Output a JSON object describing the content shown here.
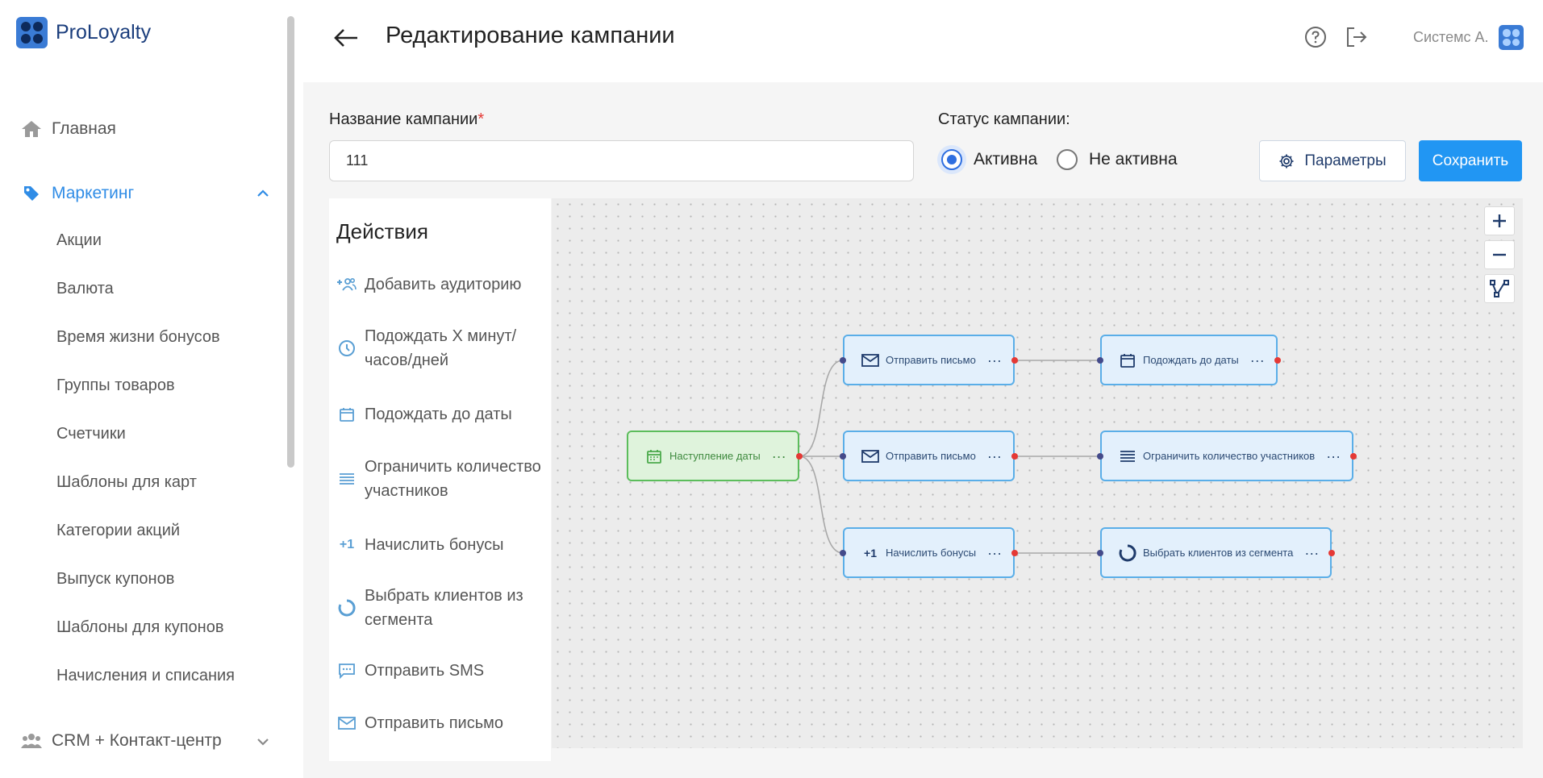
{
  "app": {
    "brand": "ProLoyalty"
  },
  "header": {
    "title": "Редактирование кампании",
    "user": "Системс А."
  },
  "sidebar": {
    "main_label": "Главная",
    "marketing_label": "Маркетинг",
    "marketing_items": [
      "Акции",
      "Валюта",
      "Время жизни бонусов",
      "Группы товаров",
      "Счетчики",
      "Шаблоны для карт",
      "Категории акций",
      "Выпуск купонов",
      "Шаблоны для купонов",
      "Начисления и списания"
    ],
    "crm_label": "CRM + Контакт-центр"
  },
  "form": {
    "name_label": "Название кампании",
    "name_required_mark": "*",
    "name_value": "111",
    "status_label": "Статус кампании:",
    "status_options": [
      "Активна",
      "Не активна"
    ],
    "status_selected": "Активна",
    "params_button": "Параметры",
    "save_button": "Сохранить"
  },
  "actions": {
    "title": "Действия",
    "items": [
      {
        "icon": "add-audience-icon",
        "label": "Добавить аудиторию"
      },
      {
        "icon": "clock-icon",
        "label": "Подождать X минут/\nчасов/дней"
      },
      {
        "icon": "calendar-icon",
        "label": "Подождать до даты"
      },
      {
        "icon": "list-icon",
        "label": "Ограничить количество\nучастников"
      },
      {
        "icon": "plus-one-icon",
        "label": "Начислить бонусы"
      },
      {
        "icon": "segment-icon",
        "label": "Выбрать клиентов из\nсегмента"
      },
      {
        "icon": "sms-icon",
        "label": "Отправить SMS"
      },
      {
        "icon": "mail-icon",
        "label": "Отправить письмо"
      }
    ]
  },
  "flow": {
    "trigger": {
      "label": "Наступление даты",
      "icon": "calendar-icon"
    },
    "nodes": [
      {
        "label": "Отправить письмо",
        "icon": "mail-icon"
      },
      {
        "label": "Отправить письмо",
        "icon": "mail-icon"
      },
      {
        "label": "Начислить бонусы",
        "icon": "plus-one-icon"
      },
      {
        "label": "Подождать до даты",
        "icon": "calendar-icon"
      },
      {
        "label": "Ограничить количество участников",
        "icon": "list-icon"
      },
      {
        "label": "Выбрать клиентов из сегмента",
        "icon": "segment-icon"
      }
    ],
    "node_menu": "···",
    "icon_plus_one": "+1"
  },
  "colors": {
    "accent": "#2196f3",
    "brand_dark": "#1a3d7c",
    "node_border": "#5aaee8",
    "trigger_border": "#5cbd5c",
    "port_out": "#e53935",
    "port_in": "#444a8a"
  }
}
